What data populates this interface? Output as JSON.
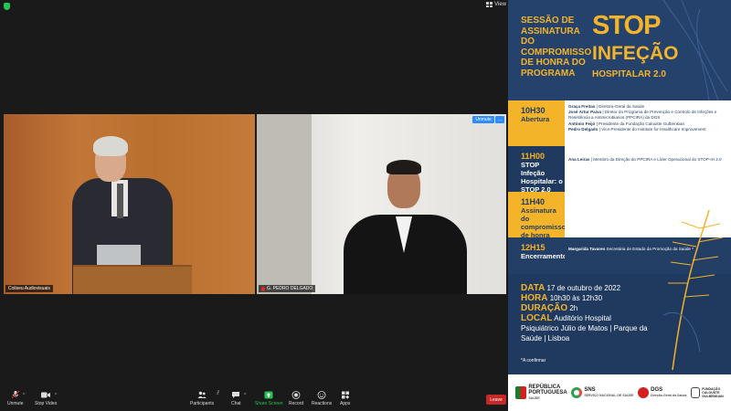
{
  "top_bar": {
    "view_label": "View"
  },
  "tiles": [
    {
      "name": "Coliseu Audiovisuais"
    },
    {
      "name": "G. PEDRO DELGADO",
      "unmute_label": "Unmute",
      "more_label": "..."
    }
  ],
  "poster": {
    "session_title": "Sessão de Assinatura do Compromisso de Honra do Programa",
    "stop": "STOP",
    "infeccao": "INFEÇÃO",
    "hospitalar": "HOSPITALAR 2.0",
    "agenda": [
      {
        "time": "10H30",
        "activity": "Abertura",
        "speakers": [
          {
            "name": "Graça Freitas",
            "role": "Diretora-Geral da Saúde"
          },
          {
            "name": "José Artur Paiva",
            "role": "Diretor do Programa de Prevenção e Controlo de Infeções e Resistência a Antimicrobianos (PPCIRA) da DGS"
          },
          {
            "name": "António Feijó",
            "role": "Presidente da Fundação Calouste Gulbenkian"
          },
          {
            "name": "Pedro Delgado",
            "role": "Vice-Presidente do Institute for Healthcare Improvement"
          }
        ]
      },
      {
        "time": "11H00",
        "activity": "STOP Infeção Hospitalar: o STOP 2.0",
        "speakers": [
          {
            "name": "Ana Leiras",
            "role": "Membro da Direção do PPCIRA e Líder Operacional do STOP-IH 2.0"
          }
        ]
      },
      {
        "time": "11H40",
        "activity": "Assinatura do compromisso de honra",
        "speakers": []
      },
      {
        "time": "12H15",
        "activity": "Encerramento",
        "speakers": [
          {
            "name": "Margarida Tavares",
            "role": "Secretária de Estado da Promoção da Saúde *"
          }
        ]
      }
    ],
    "info": {
      "data_label": "DATA",
      "data_value": "17 de outubro de 2022",
      "hora_label": "HORA",
      "hora_value": "10h30 às 12h30",
      "duracao_label": "DURAÇÃO",
      "duracao_value": "2h",
      "local_label": "LOCAL",
      "local_value": "Auditório Hospital Psiquiátrico Júlio de Matos | Parque da Saúde | Lisboa",
      "confirm": "*A confirmar"
    },
    "logos": {
      "republica_1": "REPÚBLICA",
      "republica_2": "PORTUGUESA",
      "republica_sub": "SAÚDE",
      "sns": "SNS",
      "sns_sub": "SERVIÇO NACIONAL DE SAÚDE",
      "dgs": "DGS",
      "dgs_sub": "Direção-Geral da Saúde",
      "fcg_1": "FUNDAÇÃO",
      "fcg_2": "CALOUSTE",
      "fcg_3": "GULBENKIAN"
    }
  },
  "toolbar": {
    "unmute": "Unmute",
    "stop_video": "Stop Video",
    "participants": "Participants",
    "participants_count": "2",
    "chat": "Chat",
    "share_screen": "Share Screen",
    "record": "Record",
    "reactions": "Reactions",
    "apps": "Apps",
    "leave": "Leave"
  },
  "colors": {
    "accent": "#f4b42a",
    "poster_bg": "#1f3a5e",
    "leave": "#c62828",
    "share": "#23c552"
  }
}
